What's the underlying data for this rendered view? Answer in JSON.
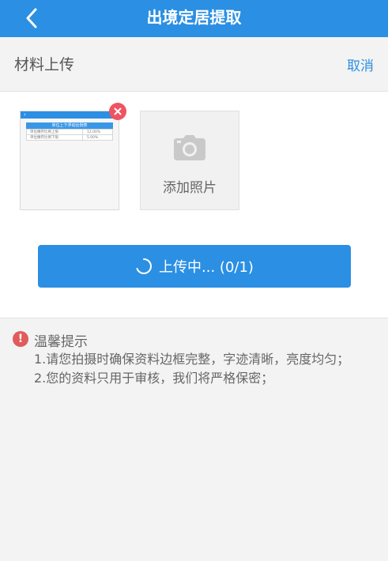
{
  "header": {
    "title": "出境定居提取",
    "back_icon": "chevron-left-icon"
  },
  "subheader": {
    "title": "材料上传",
    "cancel_label": "取消"
  },
  "thumbnail": {
    "mini_title": "单位上下浮动比例表",
    "rows": [
      {
        "name": "单位缴存比例上限",
        "value": "12.00%"
      },
      {
        "name": "单位缴存比例下限",
        "value": "5.00%"
      }
    ]
  },
  "add_photo": {
    "label": "添加照片",
    "icon": "camera-icon"
  },
  "upload_button": {
    "label": "上传中... (0/1)"
  },
  "tips": {
    "title": "温馨提示",
    "items": [
      "1.请您拍摄时确保资料边框完整，字迹清晰，亮度均匀；",
      "2.您的资料只用于审核，我们将严格保密；"
    ]
  },
  "colors": {
    "primary": "#2b8fe3",
    "danger": "#ef5361",
    "text_secondary": "#666666",
    "background": "#f3f3f3"
  }
}
